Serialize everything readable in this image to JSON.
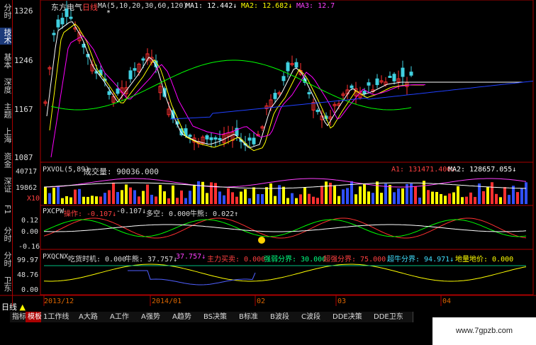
{
  "side_tabs": [
    "分时",
    "技术",
    "基本",
    "深度",
    "主题",
    "上海",
    "资金",
    "深证",
    "F1",
    "分时",
    "分时",
    "卫东"
  ],
  "side_tab_active": 1,
  "main_panel": {
    "stock": "东方电气",
    "period": "日线",
    "ma_params": "MA(5,10,20,30,60,120)",
    "ma1": "MA1: 12.442↓",
    "ma2": "MA2: 12.682↓",
    "ma3": "MA3: 12.7",
    "price_ticks": [
      "1326",
      "1246",
      "1167",
      "1087"
    ],
    "colors": {
      "ma1": "#ffffff",
      "ma2": "#ffff00",
      "ma3": "#ff00ff",
      "ma4": "#00ff00",
      "ma5": "#2040ff",
      "up": "#ff3030",
      "down": "#40d0e0"
    }
  },
  "vol_panel": {
    "title": "PXVOL(5,89)",
    "label": "成交量: 90036.000",
    "ma1": "A1: 131471.406↓",
    "ma2": "MA2: 128657.055↓",
    "ticks": [
      "40717",
      "19862",
      "X10"
    ]
  },
  "pxcpw_panel": {
    "title": "PXCPW",
    "op": "操作: -0.107↓",
    "v2": "-0.107↓",
    "duokong": "多空: 0.000",
    "niuxiong": "牛熊: 0.022↑",
    "ticks": [
      "0.12",
      "0.00",
      "-0.16"
    ]
  },
  "pxqcnx_panel": {
    "title": "PXQCNX",
    "eat": "吃货时机: 0.000",
    "niu": "牛熊: 37.757↓",
    "v3": "37.757↓",
    "main_buy": "主力买卖: 0.000",
    "strong_weak": "强弱分界: 30.000",
    "strong_split": "超强分界: 75.000",
    "super_bull": "超牛分界: 94.971↓",
    "bottom": "地量地价: 0.000",
    "ticks": [
      "99.97",
      "48.76",
      "0.00"
    ]
  },
  "dates": [
    "2013/12",
    "2014/01",
    "02",
    "03",
    "04"
  ],
  "bottom_bar": {
    "period": "日线",
    "tabs": [
      "指标",
      "模板",
      "1工作线",
      "A大路",
      "A工作",
      "A强势",
      "A趋势",
      "BS决策",
      "B标准",
      "B波段",
      "C波段",
      "DDE决策",
      "DDE卫东"
    ],
    "active": 1
  },
  "watermark": "www.7gpzb.com"
}
